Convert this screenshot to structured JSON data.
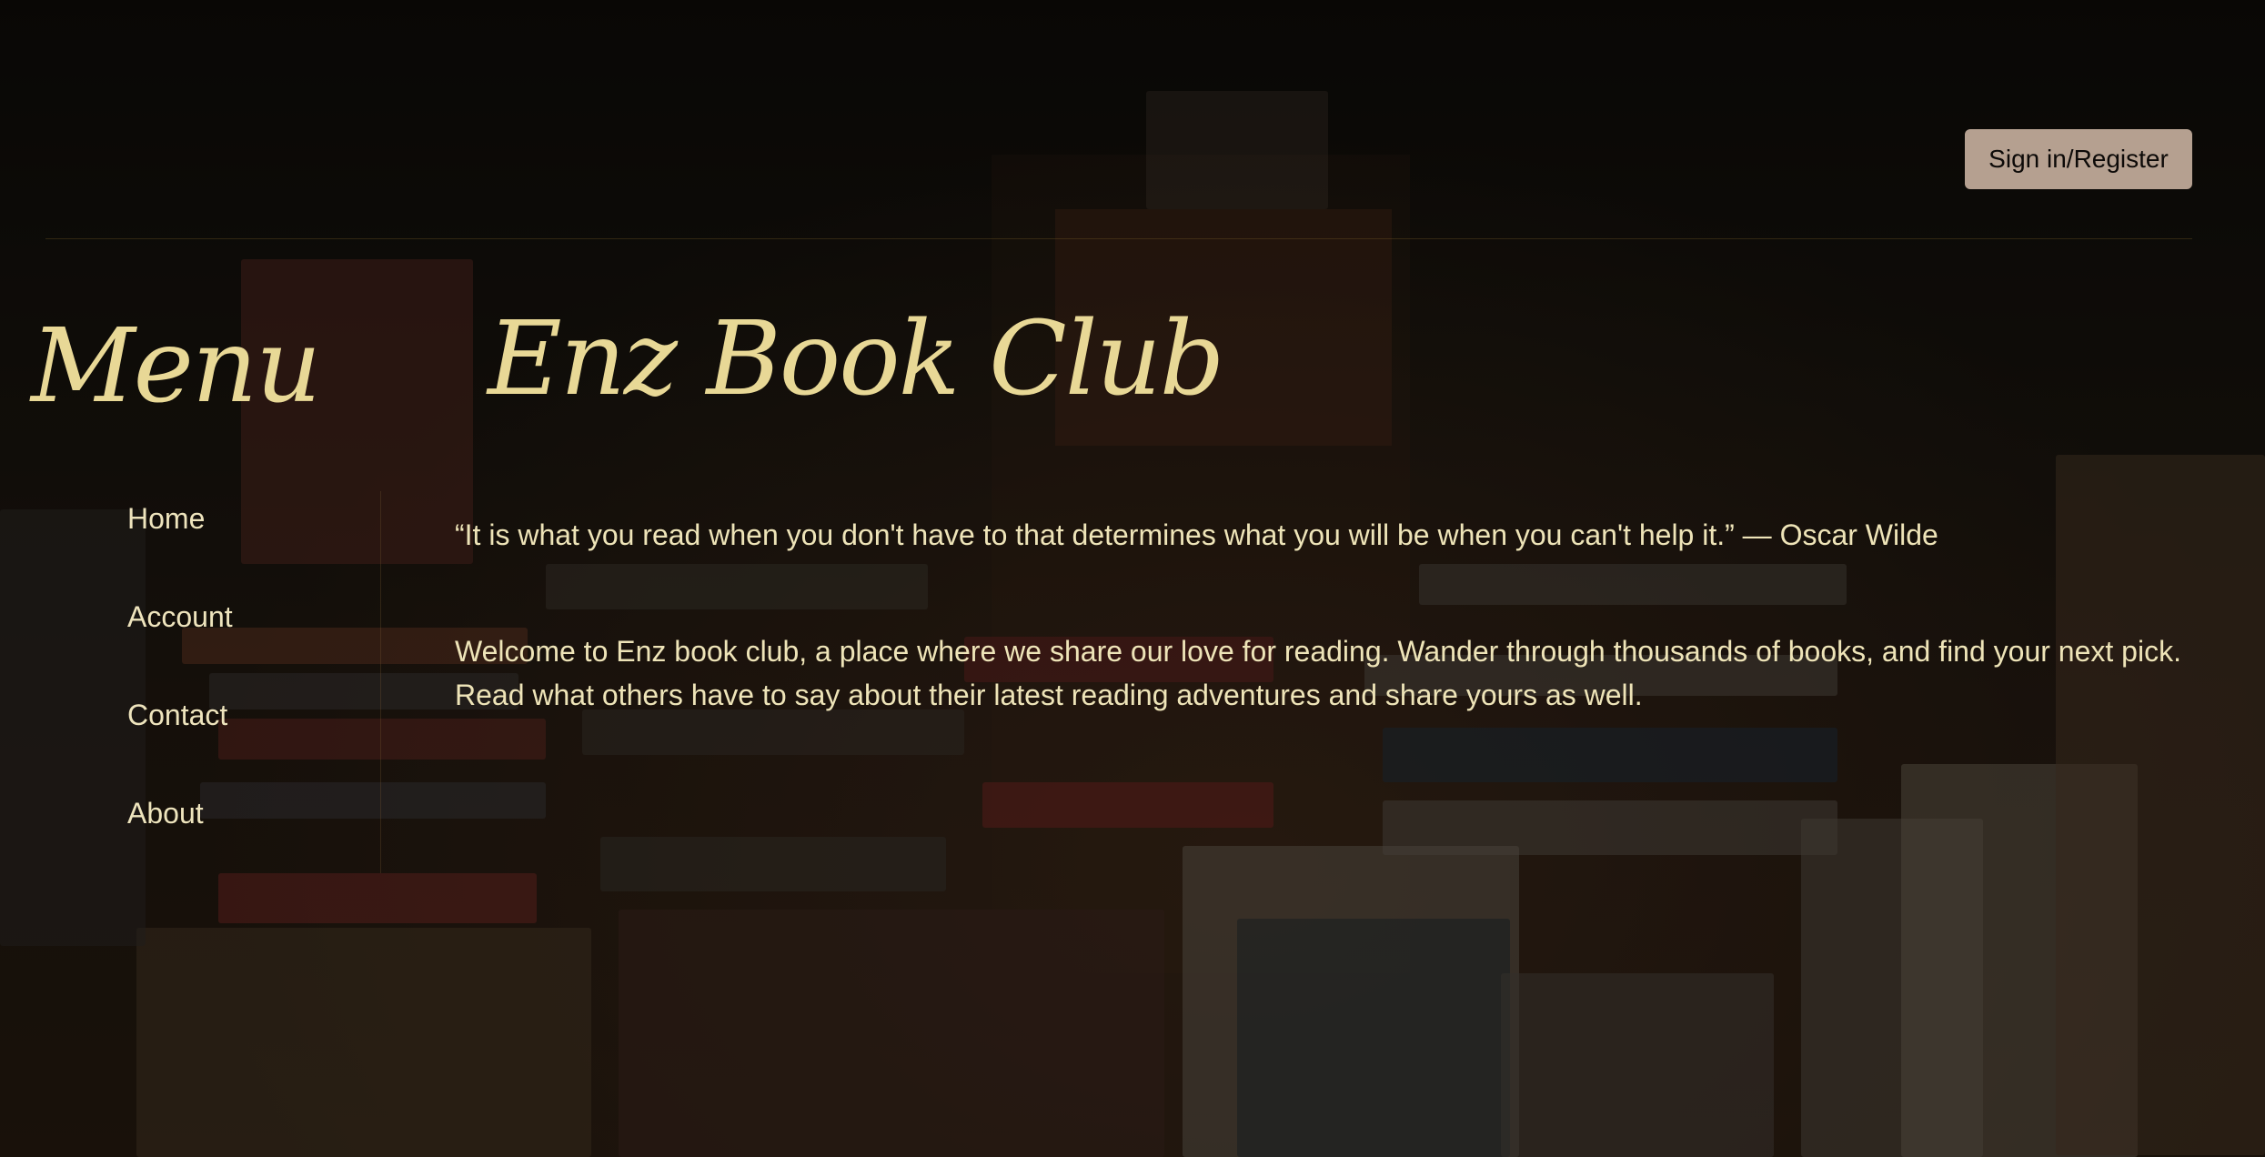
{
  "header": {
    "signin_label": "Sign in/Register"
  },
  "titles": {
    "menu": "Menu",
    "club": "Enz Book Club"
  },
  "sidebar": {
    "items": [
      {
        "label": "Home"
      },
      {
        "label": "Account"
      },
      {
        "label": "Contact"
      },
      {
        "label": "About"
      }
    ]
  },
  "main": {
    "quote": "“It is what you read when you don't have to that determines what you will be when you can't help it.” — Oscar Wilde",
    "welcome": "Welcome to Enz book club, a place where we share our love for reading. Wander through thousands of books, and find your next pick. Read what others have to say about their latest reading adventures and share yours as well."
  },
  "colors": {
    "title_gold": "#e8d896",
    "text_cream": "#eee4b8",
    "button_bg": "#b5a090",
    "background": "#0b0906"
  },
  "background_image": "bookshop-books-photo"
}
